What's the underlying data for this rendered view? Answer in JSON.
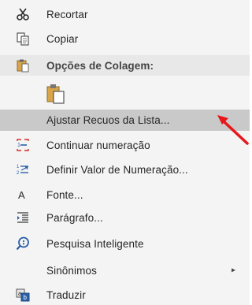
{
  "menu": {
    "items": [
      {
        "label": "Recortar",
        "icon": "scissors-icon"
      },
      {
        "label": "Copiar",
        "icon": "copy-icon"
      },
      {
        "label": "Opções de Colagem:",
        "icon": "clipboard-icon"
      },
      {
        "label": "Ajustar Recuos da Lista...",
        "icon": ""
      },
      {
        "label": "Continuar numeração",
        "icon": "continue-numbering-icon"
      },
      {
        "label": "Definir Valor de Numeração...",
        "icon": "set-numbering-value-icon"
      },
      {
        "label": "Fonte...",
        "icon": "font-icon"
      },
      {
        "label": "Parágrafo...",
        "icon": "paragraph-icon"
      },
      {
        "label": "Pesquisa Inteligente",
        "icon": "smart-lookup-icon"
      },
      {
        "label": "Sinônimos",
        "icon": "",
        "submenu_indicator": "▸"
      },
      {
        "label": "Traduzir",
        "icon": "translate-icon"
      }
    ],
    "paste_option_icon": "keep-text-only-paste-icon"
  },
  "colors": {
    "menu_bg": "#f4f4f4",
    "header_bg": "#e8e8e8",
    "highlight_bg": "#c9c9c9",
    "annotation_arrow": "#e8151b"
  }
}
